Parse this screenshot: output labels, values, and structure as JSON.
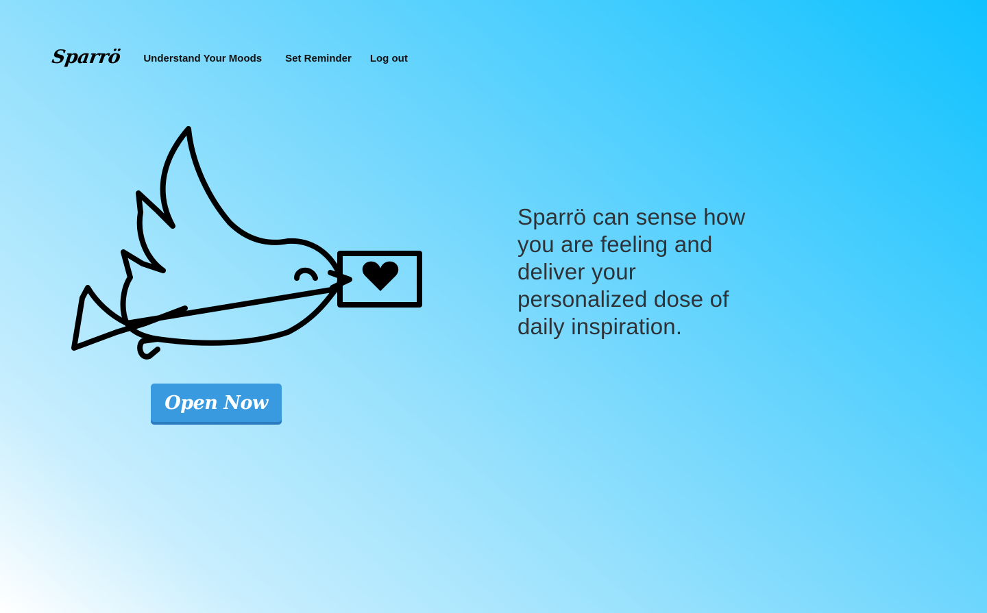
{
  "header": {
    "logo": "Sparrö",
    "nav": {
      "moods_label": "Understand Your Moods",
      "reminder_label": "Set Reminder",
      "logout_label": "Log out"
    }
  },
  "hero": {
    "illustration_icon": "bird-with-heart-envelope-icon",
    "button_label": "Open Now",
    "tagline": "Sparrö can sense how you are feeling and deliver your personalized dose of daily inspiration."
  },
  "colors": {
    "background_start": "#ffffff",
    "background_end": "#0fc2ff",
    "button": "#3a9ae0",
    "button_text": "#ffffff",
    "tagline_text": "#2e3338"
  }
}
